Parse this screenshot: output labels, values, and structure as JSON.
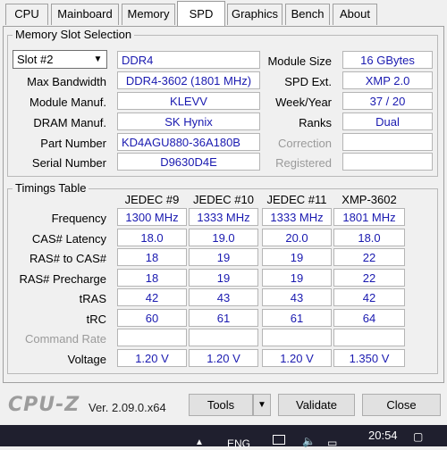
{
  "tabs": [
    "CPU",
    "Mainboard",
    "Memory",
    "SPD",
    "Graphics",
    "Bench",
    "About"
  ],
  "active_tab": "SPD",
  "slot_section": {
    "title": "Memory Slot Selection",
    "slot_select": "Slot #2",
    "type": "DDR4",
    "module_size_label": "Module Size",
    "module_size": "16 GBytes",
    "max_bandwidth_label": "Max Bandwidth",
    "max_bandwidth": "DDR4-3602 (1801 MHz)",
    "spd_ext_label": "SPD Ext.",
    "spd_ext": "XMP 2.0",
    "module_manuf_label": "Module Manuf.",
    "module_manuf": "KLEVV",
    "week_year_label": "Week/Year",
    "week_year": "37 / 20",
    "dram_manuf_label": "DRAM Manuf.",
    "dram_manuf": "SK Hynix",
    "ranks_label": "Ranks",
    "ranks": "Dual",
    "part_number_label": "Part Number",
    "part_number": "KD4AGU880-36A180B",
    "correction_label": "Correction",
    "correction": "",
    "serial_number_label": "Serial Number",
    "serial_number": "D9630D4E",
    "registered_label": "Registered",
    "registered": ""
  },
  "timings": {
    "title": "Timings Table",
    "columns": [
      "JEDEC #9",
      "JEDEC #10",
      "JEDEC #11",
      "XMP-3602"
    ],
    "rows": [
      {
        "label": "Frequency",
        "values": [
          "1300 MHz",
          "1333 MHz",
          "1333 MHz",
          "1801 MHz"
        ]
      },
      {
        "label": "CAS# Latency",
        "values": [
          "18.0",
          "19.0",
          "20.0",
          "18.0"
        ]
      },
      {
        "label": "RAS# to CAS#",
        "values": [
          "18",
          "19",
          "19",
          "22"
        ]
      },
      {
        "label": "RAS# Precharge",
        "values": [
          "18",
          "19",
          "19",
          "22"
        ]
      },
      {
        "label": "tRAS",
        "values": [
          "42",
          "43",
          "43",
          "42"
        ]
      },
      {
        "label": "tRC",
        "values": [
          "60",
          "61",
          "61",
          "64"
        ]
      },
      {
        "label": "Command Rate",
        "values": [
          "",
          "",
          "",
          ""
        ]
      },
      {
        "label": "Voltage",
        "values": [
          "1.20 V",
          "1.20 V",
          "1.20 V",
          "1.350 V"
        ]
      }
    ]
  },
  "footer": {
    "logo": "CPU-Z",
    "version": "Ver. 2.09.0.x64",
    "tools": "Tools",
    "validate": "Validate",
    "close": "Close"
  },
  "taskbar": {
    "language": "ENG",
    "time": "20:54"
  }
}
